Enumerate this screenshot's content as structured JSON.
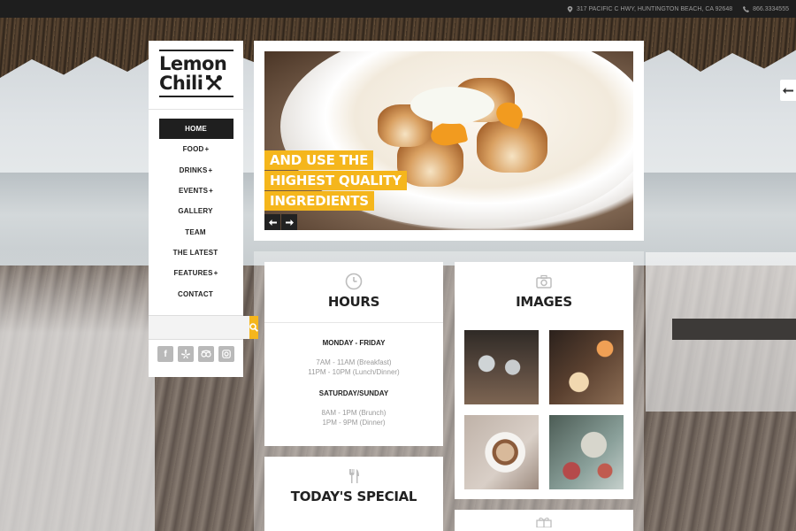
{
  "topbar": {
    "address": "317 PACIFIC C HWY, HUNTINGTON BEACH, CA 92648",
    "phone": "866.3334555"
  },
  "logo": {
    "line1": "Lemon",
    "line2": "Chili"
  },
  "nav": {
    "items": [
      {
        "label": "HOME",
        "active": true,
        "plus": ""
      },
      {
        "label": "FOOD",
        "active": false,
        "plus": "+"
      },
      {
        "label": "DRINKS",
        "active": false,
        "plus": "+"
      },
      {
        "label": "EVENTS",
        "active": false,
        "plus": "+"
      },
      {
        "label": "GALLERY",
        "active": false,
        "plus": ""
      },
      {
        "label": "TEAM",
        "active": false,
        "plus": ""
      },
      {
        "label": "THE LATEST",
        "active": false,
        "plus": ""
      },
      {
        "label": "FEATURES",
        "active": false,
        "plus": "+"
      },
      {
        "label": "CONTACT",
        "active": false,
        "plus": ""
      }
    ]
  },
  "search": {
    "placeholder": "",
    "value": ""
  },
  "social": {
    "icons": [
      "facebook-icon",
      "yelp-icon",
      "tripadvisor-icon",
      "instagram-icon"
    ]
  },
  "slider": {
    "headline": [
      "AND USE THE",
      "HIGHEST QUALITY",
      "INGREDIENTS"
    ],
    "prev_label": "⬅",
    "next_label": "➡"
  },
  "hours": {
    "title": "HOURS",
    "weekday_label": "MONDAY - FRIDAY",
    "weekday_times": [
      "7AM - 11AM (Breakfast)",
      "11PM - 10PM (Lunch/Dinner)"
    ],
    "weekend_label": "SATURDAY/SUNDAY",
    "weekend_times": [
      "8AM - 1PM (Brunch)",
      "1PM - 9PM (Dinner)"
    ]
  },
  "images": {
    "title": "IMAGES"
  },
  "special": {
    "title": "TODAY'S SPECIAL"
  },
  "colors": {
    "accent": "#f5b61c",
    "dark": "#1f1f1f",
    "muted": "#9a9a9a"
  }
}
